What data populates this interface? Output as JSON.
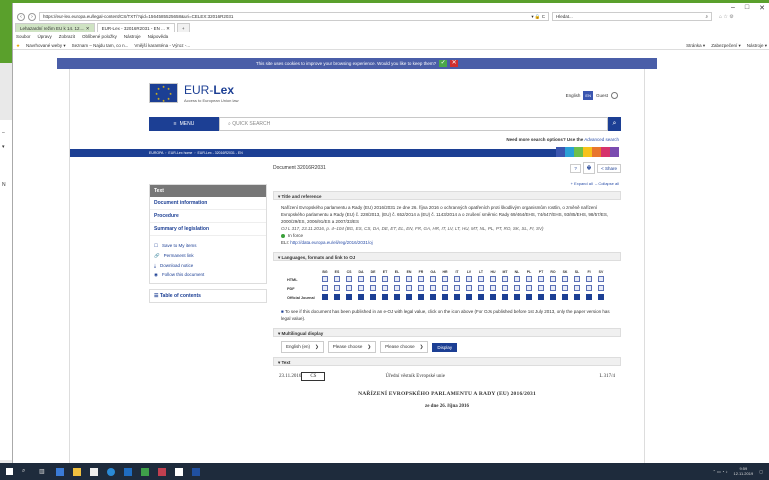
{
  "browser": {
    "url": "https://eur-lex.europa.eu/legal-content/CS/TXT/?qid=1564585525658&uri=CELEX:32016R2031",
    "url_icons": "▾ 🔒 C",
    "search_placeholder": "Hledat...",
    "window_controls": [
      "–",
      "□",
      "✕"
    ],
    "tabs": [
      {
        "label": "Lehazardní režim EU k 14. 12.... ✕"
      },
      {
        "label": "EUR-Lex - 32016R2031 - EN ... ✕"
      },
      {
        "label": "+"
      }
    ],
    "menu": [
      "Soubor",
      "Úpravy",
      "Zobrazit",
      "Oblíbené položky",
      "Nástroje",
      "Nápověda"
    ],
    "favorites_left": [
      "Navrhované weby ▾",
      "Seznam – Najdu tam, co n...",
      "Vnější karanténa - Výroz -..."
    ],
    "favorites_right": [
      "Stránka ▾",
      "Zabezpečení ▾",
      "Nástroje ▾"
    ]
  },
  "behind_window": {
    "items": [
      "–",
      "▾",
      "N"
    ]
  },
  "cookie": {
    "text": "This site uses cookies to improve your browsing experience. Would you like to keep them?",
    "yes": "✓",
    "no": "✕"
  },
  "header": {
    "logo_prefix": "EUR-",
    "logo_suffix": "Lex",
    "logo_sub": "Access to European Union law",
    "language": "English",
    "language_badge": "EN",
    "guest": "Guest"
  },
  "search": {
    "menu_label": "MENU",
    "menu_icon": "≡",
    "placeholder": "QUICK SEARCH",
    "advanced_prefix": "Need more search options? Use the",
    "advanced_link": "Advanced search"
  },
  "breadcrumb": [
    "EUROPA",
    "EUR-Lex home",
    "EUR-Lex - 32016R2031 - EN"
  ],
  "document": {
    "title": "Document 32016R2031",
    "help": "?",
    "print": "🖶",
    "share": "Share",
    "expand_all": "+ Expand all",
    "collapse_all": "– Collapse all"
  },
  "sidebar": {
    "head": "Text",
    "items": [
      "Document information",
      "Procedure",
      "Summary of legislation"
    ],
    "actions": [
      {
        "icon": "☐",
        "label": "Save to My items"
      },
      {
        "icon": "🔗",
        "label": "Permanent link"
      },
      {
        "icon": "⤓",
        "label": "Download notice"
      },
      {
        "icon": "◉",
        "label": "Follow this document"
      }
    ],
    "toc": "Table of contents",
    "toc_icon": "☰"
  },
  "sections": {
    "title_ref": {
      "head": "Title and reference",
      "text": "Nařízení Evropského parlamentu a Rady (EU) 2016/2031 ze dne 26. října 2016 o ochranných opatřeních proti škodlivým organismům rostlin, o změně nařízení Evropského parlamentu a Rady (EU) č. 228/2013, (EU) č. 652/2014 a (EU) č. 1143/2014 a o zrušení směrnic Rady 69/464/EHS, 74/647/EHS, 93/85/EHS, 98/57/ES, 2000/29/ES, 2006/91/ES a 2007/33/ES",
      "oj": "OJ L 317, 23.11.2016, p. 4–104 (BG, ES, CS, DA, DE, ET, EL, EN, FR, GA, HR, IT, LV, LT, HU, MT, NL, PL, PT, RO, SK, SL, FI, SV)",
      "status": "In force",
      "eli_label": "ELI:",
      "eli_link": "http://data.europa.eu/eli/reg/2016/2031/oj"
    },
    "languages": {
      "head": "Languages, formats and link to OJ",
      "codes": [
        "BG",
        "ES",
        "CS",
        "DA",
        "DE",
        "ET",
        "EL",
        "EN",
        "FR",
        "GA",
        "HR",
        "IT",
        "LV",
        "LT",
        "HU",
        "MT",
        "NL",
        "PL",
        "PT",
        "RO",
        "SK",
        "SL",
        "FI",
        "SV"
      ],
      "rows": [
        "HTML",
        "PDF",
        "Official Journal"
      ],
      "note": "To see if this document has been published in an e-OJ with legal value, click on the icon above (For OJs published before 1st July 2013, only the paper version has legal value)."
    },
    "multilingual": {
      "head": "Multilingual display",
      "select1": "English (en)",
      "select2": "Please choose",
      "select3": "Please choose",
      "chevron": "❯",
      "display": "Display"
    },
    "text": {
      "head": "Text",
      "date": "23.11.2016",
      "lang": "CS",
      "journal": "Úřední věstník Evropské unie",
      "page": "L 317/4",
      "reg_title": "NAŘÍZENÍ EVROPSKÉHO PARLAMENTU A RADY (EU) 2016/2031",
      "reg_date": "ze dne 26. října 2016"
    }
  },
  "taskbar": {
    "time": "9:59",
    "date": "12.11.2019"
  },
  "colors": {
    "brand": "#1c3f94",
    "strip": [
      "#3b56b0",
      "#2aa0d6",
      "#6dbf4b",
      "#f7c21b",
      "#e8762d",
      "#d6336c",
      "#7a4cb0"
    ]
  }
}
